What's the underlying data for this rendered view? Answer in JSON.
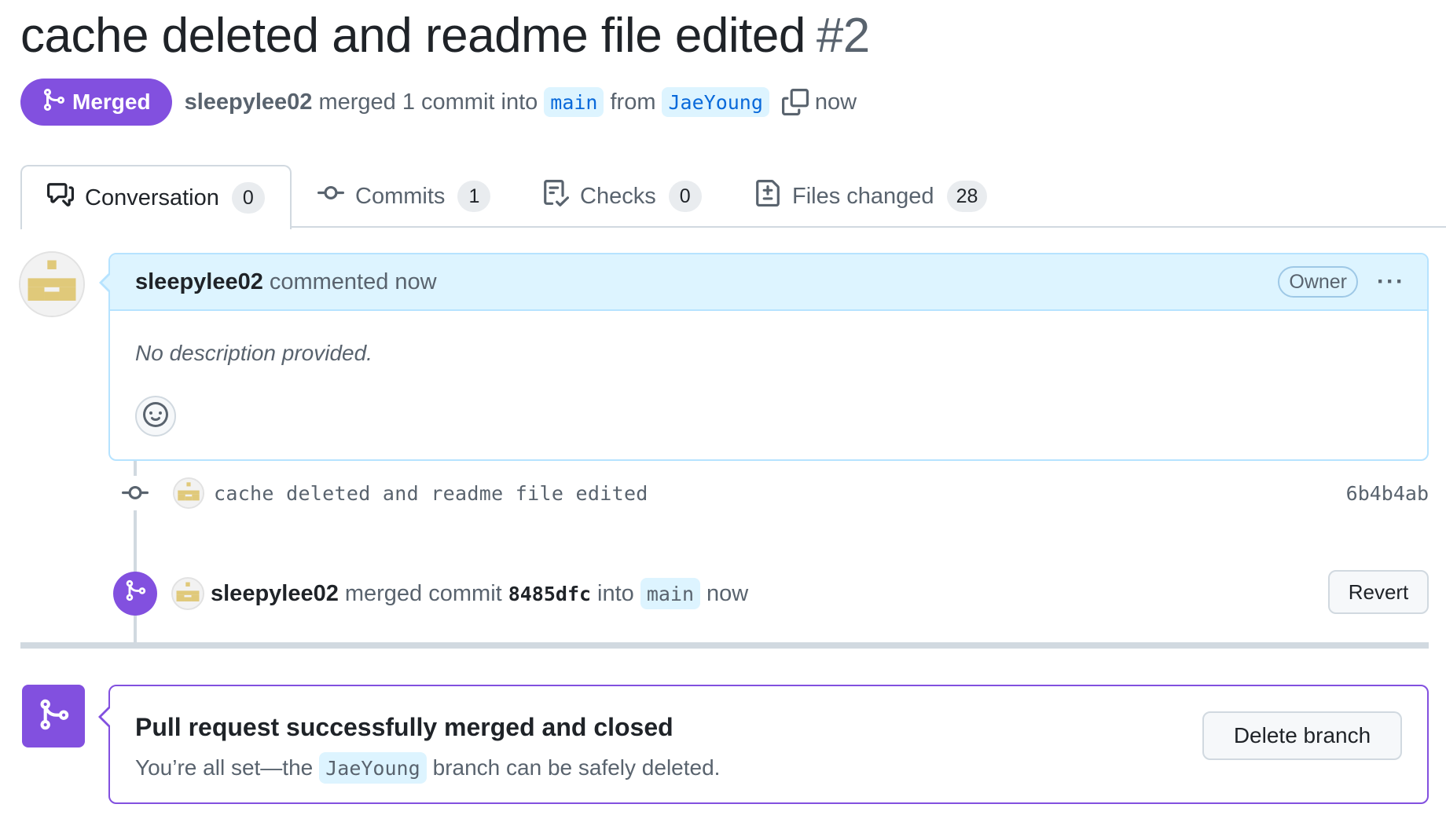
{
  "pr": {
    "title": "cache deleted and readme file edited",
    "number": "#2",
    "state": "Merged",
    "author": "sleepylee02",
    "merge_text": "merged 1 commit into",
    "base_branch": "main",
    "from_text": "from",
    "head_branch": "JaeYoung",
    "time": "now"
  },
  "tabs": [
    {
      "label": "Conversation",
      "count": "0",
      "icon": "comment-discussion-icon"
    },
    {
      "label": "Commits",
      "count": "1",
      "icon": "git-commit-icon"
    },
    {
      "label": "Checks",
      "count": "0",
      "icon": "checklist-icon"
    },
    {
      "label": "Files changed",
      "count": "28",
      "icon": "file-diff-icon"
    }
  ],
  "comment": {
    "author": "sleepylee02",
    "action": "commented now",
    "role": "Owner",
    "menu": "···",
    "body": "No description provided."
  },
  "commit": {
    "message": "cache deleted and readme file edited",
    "sha": "6b4b4ab"
  },
  "merge_event": {
    "author": "sleepylee02",
    "text1": "merged commit",
    "sha": "8485dfc",
    "text2": "into",
    "branch": "main",
    "time": "now",
    "revert_label": "Revert"
  },
  "merged_box": {
    "title": "Pull request successfully merged and closed",
    "text_before": "You’re all set—the",
    "branch": "JaeYoung",
    "text_after": "branch can be safely deleted.",
    "delete_label": "Delete branch"
  },
  "colors": {
    "merged_purple": "#8250df",
    "info_blue": "#ddf4ff",
    "link_blue": "#0969da",
    "avatar_tan": "#e0c97a"
  }
}
